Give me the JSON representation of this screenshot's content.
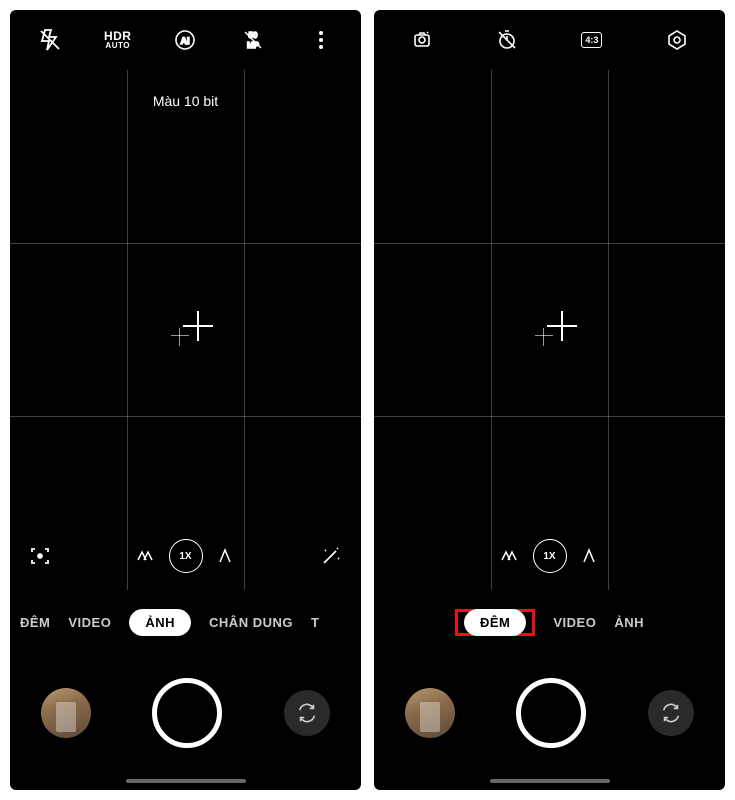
{
  "left": {
    "top_icons": [
      "flash-off",
      "hdr-auto",
      "ai",
      "raw-50mp",
      "more"
    ],
    "hdr_label": "HDR",
    "hdr_sub": "AUTO",
    "viewfinder_label": "Màu 10 bit",
    "zoom_label": "1X",
    "modes": [
      {
        "label": "ĐÊM",
        "active": false
      },
      {
        "label": "VIDEO",
        "active": false
      },
      {
        "label": "ẢNH",
        "active": true
      },
      {
        "label": "CHÂN DUNG",
        "active": false
      },
      {
        "label": "T",
        "active": false
      }
    ]
  },
  "right": {
    "top_icons": [
      "beauty",
      "timer-off",
      "aspect-43",
      "settings"
    ],
    "aspect_label": "4:3",
    "zoom_label": "1X",
    "modes": [
      {
        "label": "ĐÊM",
        "active": true,
        "highlight": true
      },
      {
        "label": "VIDEO",
        "active": false
      },
      {
        "label": "ẢNH",
        "active": false
      }
    ]
  }
}
